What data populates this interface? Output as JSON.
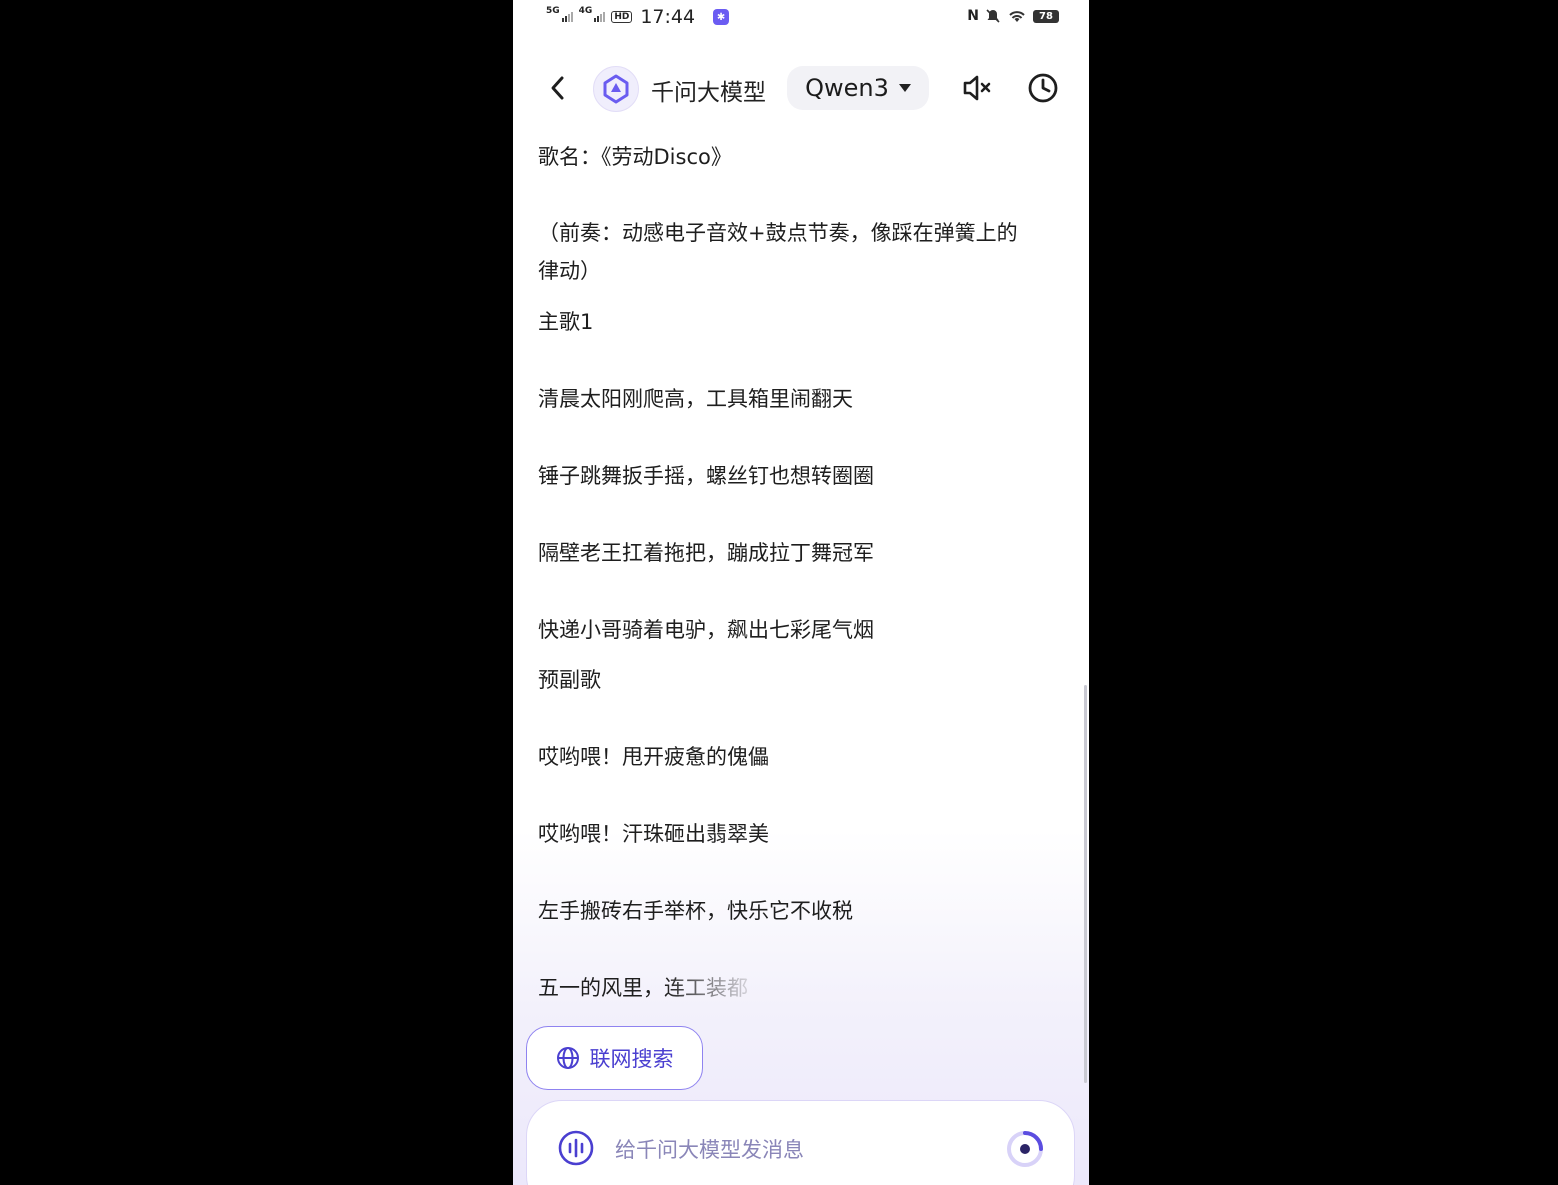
{
  "status_bar": {
    "signal1_label": "5G",
    "signal2_label": "4G",
    "hd_label": "HD",
    "time": "17:44",
    "battery": "78",
    "nfc_label": "N"
  },
  "header": {
    "app_name": "千问大模型",
    "model_label": "Qwen3"
  },
  "content": {
    "lines": [
      "歌名：《劳动Disco》",
      "（前奏：动感电子音效+鼓点节奏，像踩在弹簧上的",
      "律动）",
      "主歌1",
      "清晨太阳刚爬高，工具箱里闹翻天",
      "锤子跳舞扳手摇，螺丝钉也想转圈圈",
      "隔壁老王扛着拖把，蹦成拉丁舞冠军",
      "快递小哥骑着电驴，飙出七彩尾气烟",
      "预副歌",
      "哎哟喂！甩开疲惫的傀儡",
      "哎哟喂！汗珠砸出翡翠美",
      "左手搬砖右手举杯，快乐它不收税",
      "五一的风里，连工装都"
    ]
  },
  "web_search": {
    "label": "联网搜索"
  },
  "composer": {
    "placeholder": "给千问大模型发消息"
  },
  "colors": {
    "accent": "#5b4de0",
    "accent_light": "#8f83f0"
  }
}
